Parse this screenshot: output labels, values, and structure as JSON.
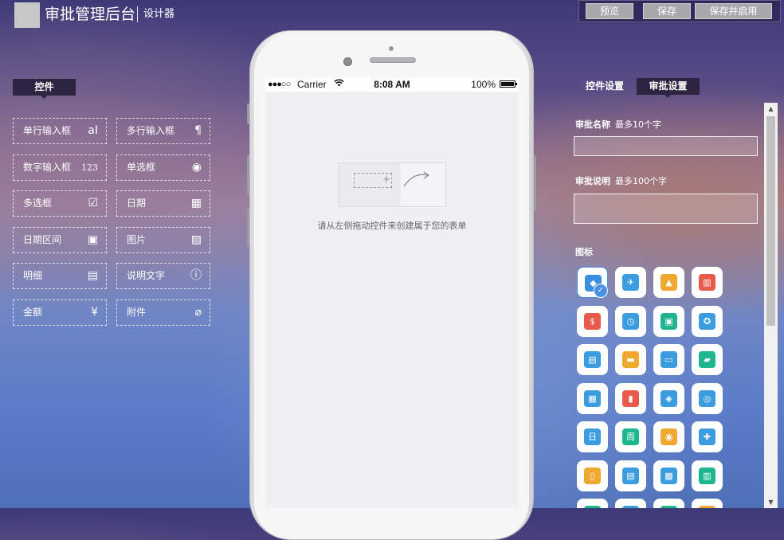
{
  "header": {
    "title": "审批管理后台",
    "subtitle": "设计器",
    "buttons": {
      "preview": "预览",
      "save": "保存",
      "save_enable": "保存并启用"
    }
  },
  "left_panel": {
    "tab": "控件",
    "controls": [
      {
        "label": "单行输入框",
        "icon": "aI"
      },
      {
        "label": "多行输入框",
        "icon": "¶"
      },
      {
        "label": "数字输入框",
        "icon": "123"
      },
      {
        "label": "单选框",
        "icon": "◉"
      },
      {
        "label": "多选框",
        "icon": "☑"
      },
      {
        "label": "日期",
        "icon": "▦"
      },
      {
        "label": "日期区间",
        "icon": "▣"
      },
      {
        "label": "图片",
        "icon": "▨"
      },
      {
        "label": "明细",
        "icon": "▤"
      },
      {
        "label": "说明文字",
        "icon": "ⓘ"
      },
      {
        "label": "金额",
        "icon": "¥"
      },
      {
        "label": "附件",
        "icon": "⌀"
      }
    ]
  },
  "phone": {
    "status": {
      "signal": "●●●○○",
      "carrier": "Carrier",
      "time": "8:08 AM",
      "battery": "100%"
    },
    "hint": "请从左侧拖动控件来创建属于您的表单"
  },
  "right_panel": {
    "tabs": {
      "control_settings": "控件设置",
      "approval_settings": "审批设置"
    },
    "approval_name": {
      "label": "审批名称",
      "hint": "最多10个字",
      "value": ""
    },
    "approval_desc": {
      "label": "审批说明",
      "hint": "最多100个字",
      "value": ""
    },
    "icons_label": "图标",
    "icons": [
      {
        "name": "eraser-icon",
        "color": "#3b8fe0",
        "glyph": "◆",
        "selected": true
      },
      {
        "name": "airplane-icon",
        "color": "#3b9de0",
        "glyph": "✈"
      },
      {
        "name": "car-icon",
        "color": "#f0a830",
        "glyph": "▲"
      },
      {
        "name": "gift-icon",
        "color": "#e85a4a",
        "glyph": "▥"
      },
      {
        "name": "money-bag-icon",
        "color": "#e85a4a",
        "glyph": "$"
      },
      {
        "name": "clock-icon",
        "color": "#3b9de0",
        "glyph": "◷"
      },
      {
        "name": "cube-icon",
        "color": "#1fb58f",
        "glyph": "▣"
      },
      {
        "name": "medal-icon",
        "color": "#3b9de0",
        "glyph": "✪"
      },
      {
        "name": "clipboard-icon",
        "color": "#3b9de0",
        "glyph": "▤"
      },
      {
        "name": "paint-roller-icon",
        "color": "#f0a830",
        "glyph": "▬"
      },
      {
        "name": "card-icon",
        "color": "#3b9de0",
        "glyph": "▭"
      },
      {
        "name": "chat-icon",
        "color": "#1fb58f",
        "glyph": "▰"
      },
      {
        "name": "shop-icon",
        "color": "#3b9de0",
        "glyph": "▦"
      },
      {
        "name": "bar-chart-icon",
        "color": "#e85a4a",
        "glyph": "▮"
      },
      {
        "name": "tag-icon",
        "color": "#3b9de0",
        "glyph": "◈"
      },
      {
        "name": "support-icon",
        "color": "#3b9de0",
        "glyph": "◎"
      },
      {
        "name": "day-icon",
        "color": "#3b9de0",
        "glyph": "日"
      },
      {
        "name": "week-icon",
        "color": "#1fb58f",
        "glyph": "周"
      },
      {
        "name": "team-icon",
        "color": "#f0a830",
        "glyph": "◉"
      },
      {
        "name": "user-add-icon",
        "color": "#3b9de0",
        "glyph": "✚"
      },
      {
        "name": "door-icon",
        "color": "#f0a830",
        "glyph": "▯"
      },
      {
        "name": "document-icon",
        "color": "#3b9de0",
        "glyph": "▤"
      },
      {
        "name": "bus-icon",
        "color": "#3b9de0",
        "glyph": "▩"
      },
      {
        "name": "bank-icon",
        "color": "#1fb58f",
        "glyph": "▥"
      },
      {
        "name": "misc-icon-1",
        "color": "#1fb58f",
        "glyph": "■"
      },
      {
        "name": "misc-icon-2",
        "color": "#3b9de0",
        "glyph": "■"
      },
      {
        "name": "misc-icon-3",
        "color": "#1fb58f",
        "glyph": "■"
      },
      {
        "name": "misc-icon-4",
        "color": "#f0a830",
        "glyph": "■"
      }
    ]
  }
}
